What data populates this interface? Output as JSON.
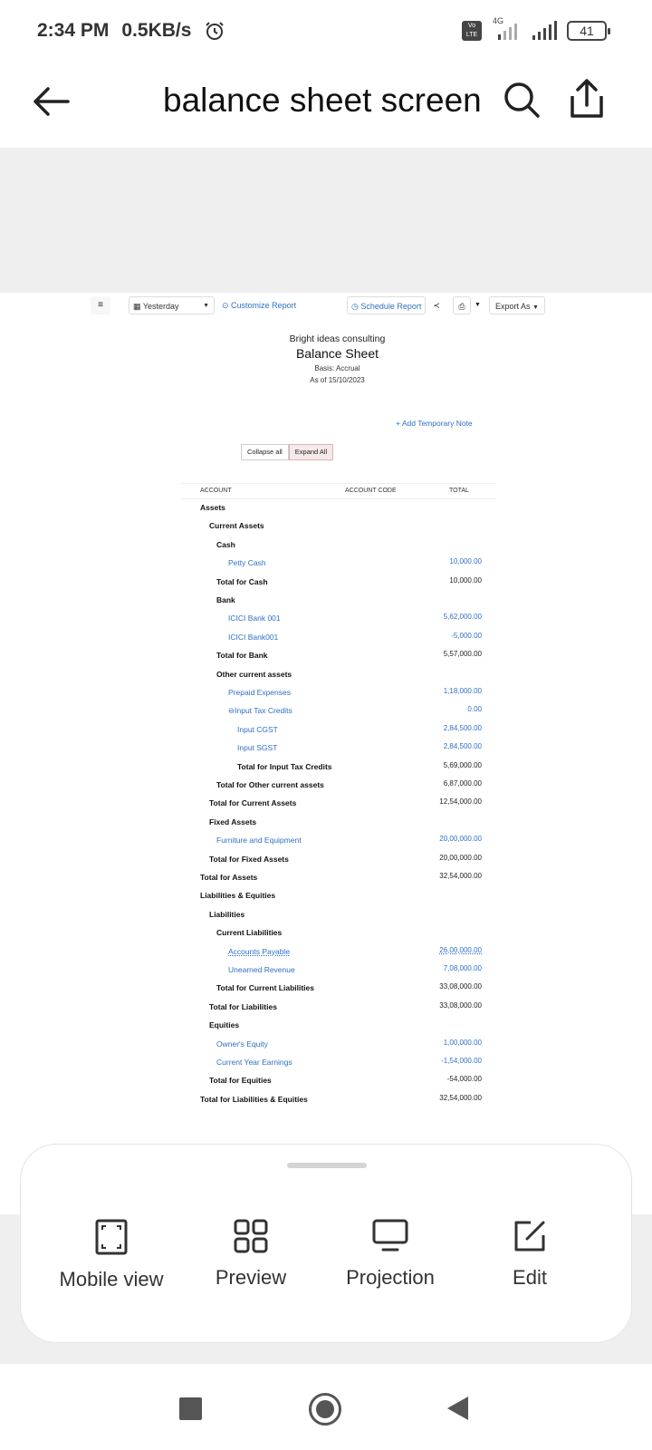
{
  "status_bar": {
    "time": "2:34 PM",
    "speed": "0.5KB/s",
    "alarm_icon": "alarm-clock-icon",
    "volte": "Vo LTE",
    "network": "4G",
    "battery": "41"
  },
  "app_bar": {
    "title": "balance sheet screen",
    "back_icon": "arrow-left-icon",
    "search_icon": "search-icon",
    "share_icon": "share-icon"
  },
  "report": {
    "toolbar": {
      "menu_icon": "hamburger-icon",
      "period": "Yesterday",
      "customize": "Customize Report",
      "schedule": "Schedule Report",
      "export": "Export As"
    },
    "company": "Bright ideas consulting",
    "title": "Balance Sheet",
    "basis": "Basis: Accrual",
    "as_of": "As of 15/10/2023",
    "add_note": "+ Add Temporary Note",
    "collapse_all": "Collapse all",
    "expand_all": "Expand All",
    "columns": [
      "ACCOUNT",
      "ACCOUNT CODE",
      "TOTAL"
    ],
    "rows": [
      {
        "label": "Assets",
        "amount": "",
        "indent": 0,
        "style": "bold"
      },
      {
        "label": "Current Assets",
        "amount": "",
        "indent": 1,
        "style": "bold"
      },
      {
        "label": "Cash",
        "amount": "",
        "indent": 2,
        "style": "bold"
      },
      {
        "label": "Petty Cash",
        "amount": "10,000.00",
        "indent": 3,
        "style": "link"
      },
      {
        "label": "Total for Cash",
        "amount": "10,000.00",
        "indent": 2,
        "style": "bold"
      },
      {
        "label": "Bank",
        "amount": "",
        "indent": 2,
        "style": "bold"
      },
      {
        "label": "ICICI Bank 001",
        "amount": "5,62,000.00",
        "indent": 3,
        "style": "link"
      },
      {
        "label": "ICICI Bank001",
        "amount": "-5,000.00",
        "indent": 3,
        "style": "link"
      },
      {
        "label": "Total for Bank",
        "amount": "5,57,000.00",
        "indent": 2,
        "style": "bold"
      },
      {
        "label": "Other current assets",
        "amount": "",
        "indent": 2,
        "style": "bold"
      },
      {
        "label": "Prepaid Expenses",
        "amount": "1,18,000.00",
        "indent": 3,
        "style": "link"
      },
      {
        "label": "⊖Input Tax Credits",
        "amount": "0.00",
        "indent": 3,
        "style": "link"
      },
      {
        "label": "Input CGST",
        "amount": "2,84,500.00",
        "indent": 4,
        "style": "link"
      },
      {
        "label": "Input SGST",
        "amount": "2,84,500.00",
        "indent": 4,
        "style": "link"
      },
      {
        "label": "Total for Input Tax Credits",
        "amount": "5,69,000.00",
        "indent": 4,
        "style": "bold"
      },
      {
        "label": "Total for Other current assets",
        "amount": "6,87,000.00",
        "indent": 2,
        "style": "bold"
      },
      {
        "label": "Total for Current Assets",
        "amount": "12,54,000.00",
        "indent": 1,
        "style": "bold"
      },
      {
        "label": "Fixed Assets",
        "amount": "",
        "indent": 1,
        "style": "bold"
      },
      {
        "label": "Furniture and Equipment",
        "amount": "20,00,000.00",
        "indent": 2,
        "style": "link"
      },
      {
        "label": "Total for Fixed Assets",
        "amount": "20,00,000.00",
        "indent": 1,
        "style": "bold"
      },
      {
        "label": "Total for Assets",
        "amount": "32,54,000.00",
        "indent": 0,
        "style": "bold"
      },
      {
        "label": "Liabilities & Equities",
        "amount": "",
        "indent": 0,
        "style": "bold"
      },
      {
        "label": "Liabilities",
        "amount": "",
        "indent": 1,
        "style": "bold"
      },
      {
        "label": "Current Liabilities",
        "amount": "",
        "indent": 2,
        "style": "bold"
      },
      {
        "label": "Accounts Payable",
        "amount": "26,00,000.00",
        "indent": 3,
        "style": "link-u"
      },
      {
        "label": "Unearned Revenue",
        "amount": "7,08,000.00",
        "indent": 3,
        "style": "link"
      },
      {
        "label": "Total for Current Liabilities",
        "amount": "33,08,000.00",
        "indent": 2,
        "style": "bold"
      },
      {
        "label": "Total for Liabilities",
        "amount": "33,08,000.00",
        "indent": 1,
        "style": "bold"
      },
      {
        "label": "Equities",
        "amount": "",
        "indent": 1,
        "style": "bold"
      },
      {
        "label": "Owner's Equity",
        "amount": "1,00,000.00",
        "indent": 2,
        "style": "link"
      },
      {
        "label": "Current Year Earnings",
        "amount": "-1,54,000.00",
        "indent": 2,
        "style": "link"
      },
      {
        "label": "Total for Equities",
        "amount": "-54,000.00",
        "indent": 1,
        "style": "bold"
      },
      {
        "label": "Total for Liabilities & Equities",
        "amount": "32,54,000.00",
        "indent": 0,
        "style": "bold"
      }
    ]
  },
  "bottom_sheet": {
    "items": [
      {
        "label": "Mobile view",
        "icon": "fullscreen-icon"
      },
      {
        "label": "Preview",
        "icon": "grid-icon"
      },
      {
        "label": "Projection",
        "icon": "monitor-icon"
      },
      {
        "label": "Edit",
        "icon": "edit-icon"
      }
    ]
  },
  "colors": {
    "link": "#2f6fc4",
    "background_band": "#efefef",
    "icon": "#333333"
  }
}
